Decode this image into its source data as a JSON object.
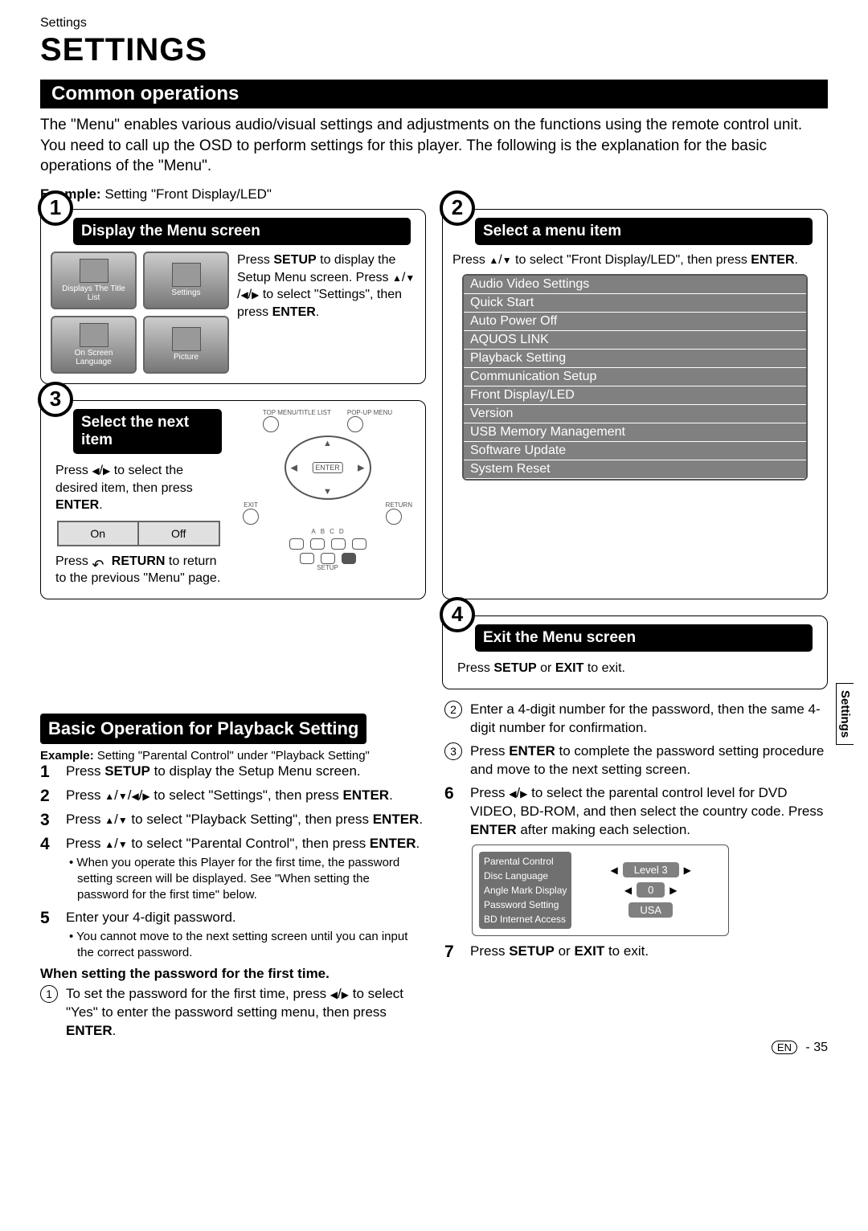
{
  "header": {
    "small_title": "Settings",
    "big_title": "SETTINGS"
  },
  "common_ops_bar": "Common operations",
  "intro": "The \"Menu\" enables various audio/visual settings and adjustments on the functions using the remote control unit. You need to call up the OSD to perform settings for this player. The following is the explanation for the basic operations of the \"Menu\".",
  "example_label": "Example:",
  "example_text": " Setting \"Front Display/LED\"",
  "step1": {
    "number": "1",
    "title": "Display the Menu screen",
    "icons": {
      "a": "Displays The Title List",
      "b": "Settings",
      "c": "On Screen Language",
      "d": "Picture"
    },
    "text": "Press SETUP to display the Setup Menu screen. Press ▲/▼/◀/▶ to select \"Settings\", then press ENTER."
  },
  "step2": {
    "number": "2",
    "title": "Select a menu item",
    "instr": "Press ▲/▼ to select \"Front Display/LED\", then press ENTER.",
    "list": [
      "Audio Video Settings",
      "Quick Start",
      "Auto Power Off",
      "AQUOS LINK",
      "Playback Setting",
      "Communication Setup",
      "Front Display/LED",
      "Version",
      "USB Memory Management",
      "Software Update",
      "System Reset"
    ]
  },
  "step3": {
    "number": "3",
    "title": "Select the next item",
    "instr1": "Press ◀/▶ to select the desired item, then press ENTER.",
    "on": "On",
    "off": "Off",
    "instr2_pre": "Press ",
    "instr2_return": "RETURN",
    "instr2_post": " to return to the previous \"Menu\" page.",
    "remote": {
      "top_left": "TOP MENU/TITLE LIST",
      "top_right": "POP-UP MENU",
      "enter": "ENTER",
      "exit": "EXIT",
      "return": "RETURN",
      "abcd": [
        "A",
        "B",
        "C",
        "D"
      ],
      "setup": "SETUP"
    }
  },
  "step4": {
    "number": "4",
    "title": "Exit the Menu screen",
    "instr": "Press SETUP or EXIT to exit."
  },
  "basic": {
    "title": "Basic Operation for Playback Setting",
    "example_label": "Example:",
    "example_text": " Setting \"Parental Control\" under \"Playback Setting\"",
    "left_steps": {
      "s1": {
        "n": "1",
        "t": "Press SETUP to display the Setup Menu screen."
      },
      "s2": {
        "n": "2",
        "t": "Press ▲/▼/◀/▶ to select \"Settings\", then press ENTER."
      },
      "s3": {
        "n": "3",
        "t": "Press ▲/▼ to select \"Playback Setting\", then press ENTER."
      },
      "s4": {
        "n": "4",
        "t": "Press ▲/▼ to select \"Parental Control\", then press ENTER.",
        "b": "When you operate this Player for the first time, the password setting screen will be displayed. See \"When setting the password for the first time\" below."
      },
      "s5": {
        "n": "5",
        "t": "Enter your 4-digit password.",
        "b": "You cannot move to the next setting screen until you can input the correct password."
      }
    },
    "when_first": "When setting the password for the first time.",
    "circ1": "To set the password for the first time, press ◀/▶ to select \"Yes\" to enter the password setting menu, then press ENTER.",
    "right_steps": {
      "c2": "Enter a 4-digit number for the password, then the same 4-digit number for confirmation.",
      "c3": "Press ENTER to complete the password setting procedure and move to the next setting screen.",
      "s6": {
        "n": "6",
        "t": "Press ◀/▶ to select the parental control level for DVD VIDEO, BD-ROM, and then select the country code. Press ENTER after making each selection."
      },
      "s7": {
        "n": "7",
        "t": "Press SETUP or EXIT to exit."
      }
    },
    "parental": {
      "items": [
        "Parental Control",
        "Disc Language",
        "Angle Mark Display",
        "Password Setting",
        "BD Internet Access"
      ],
      "level": "Level 3",
      "zero": "0",
      "country": "USA"
    }
  },
  "side_tab": "Settings",
  "page_num": {
    "en": "EN",
    "dash": "-",
    "num": "35"
  }
}
